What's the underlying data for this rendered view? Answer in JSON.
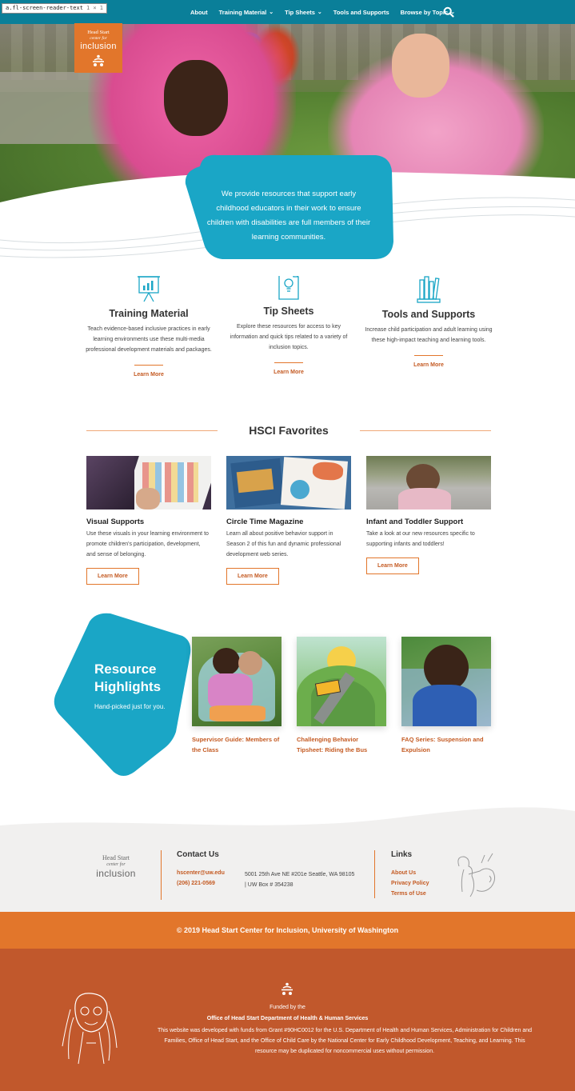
{
  "tooltip": {
    "label": "a.fl-screen-reader-text",
    "dims": "1 × 1"
  },
  "nav": {
    "items": [
      {
        "label": "About",
        "dropdown": false
      },
      {
        "label": "Training Material",
        "dropdown": true
      },
      {
        "label": "Tip Sheets",
        "dropdown": true
      },
      {
        "label": "Tools and Supports",
        "dropdown": false
      },
      {
        "label": "Browse by Topic",
        "dropdown": true
      }
    ],
    "search_icon": "search-icon",
    "chevron": "⌄"
  },
  "logo": {
    "line1": "Head Start",
    "line2": "center for",
    "line3": "inclusion"
  },
  "hero": {
    "text": "We provide resources that support early childhood educators in their work to ensure children with disabilities are full members of their learning communities."
  },
  "features": [
    {
      "title": "Training Material",
      "desc": "Teach evidence-based inclusive practices in early learning environments use these multi-media professional development materials and packages.",
      "link": "Learn More",
      "icon": "presentation-chart-icon"
    },
    {
      "title": "Tip Sheets",
      "desc": "Explore these resources for access to key information and quick tips related to a variety of inclusion topics.",
      "link": "Learn More",
      "icon": "lightbulb-document-icon"
    },
    {
      "title": "Tools and Supports",
      "desc": "Increase child participation and adult learning using these high-impact teaching and learning tools.",
      "link": "Learn More",
      "icon": "books-icon"
    }
  ],
  "favorites": {
    "heading": "HSCI Favorites",
    "cards": [
      {
        "title": "Visual Supports",
        "desc": "Use these visuals in your learning environment to promote children's participation, development, and sense of belonging.",
        "button": "Learn More"
      },
      {
        "title": "Circle Time Magazine",
        "desc": "Learn all about positive behavior support in Season 2 of this fun and dynamic professional development web series.",
        "button": "Learn More"
      },
      {
        "title": "Infant and Toddler Support",
        "desc": "Take a look at our new resources specific to supporting infants and toddlers!",
        "button": "Learn More"
      }
    ]
  },
  "resources": {
    "title_line1": "Resource",
    "title_line2": "Highlights",
    "subtitle": "Hand-picked just for you.",
    "items": [
      {
        "title": "Supervisor Guide: Members of the Class"
      },
      {
        "title": "Challenging Behavior Tipsheet: Riding the Bus"
      },
      {
        "title": "FAQ Series: Suspension and Expulsion"
      }
    ]
  },
  "footer": {
    "logo": {
      "line1": "Head Start",
      "line2": "center for",
      "line3": "inclusion"
    },
    "contact_heading": "Contact Us",
    "email": "hscenter@uw.edu",
    "phone": "(206) 221-0569",
    "address": "5001 25th Ave NE #201e Seattle, WA 98105 | UW Box # 354238",
    "links_heading": "Links",
    "links": [
      "About Us",
      "Privacy Policy",
      "Terms of Use"
    ]
  },
  "copyright": "© 2019 Head Start Center for Inclusion, University of Washington",
  "bottom": {
    "funded_by": "Funded by the",
    "office": "Office of Head Start Department of Health & Human Services",
    "disclaimer": "This website was developed with funds from Grant #90HC0012 for the U.S. Department of Health and Human Services, Administration for Children and Families, Office of Head Start, and the Office of Child Care by the National Center for Early Childhood Development, Teaching, and Learning. This resource may be duplicated for noncommercial uses without permission."
  },
  "colors": {
    "teal": "#0a7f99",
    "hero_teal": "#1aa6c6",
    "orange": "#e2762b",
    "rust": "#c1582c",
    "link": "#c45a22"
  }
}
